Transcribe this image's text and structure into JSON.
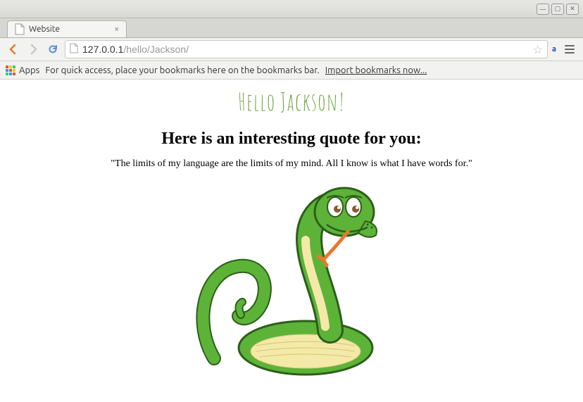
{
  "window": {
    "tab_title": "Website"
  },
  "toolbar": {
    "url_host": "127.0.0.1",
    "url_path": "/hello/Jackson/"
  },
  "bookmarks": {
    "apps_label": "Apps",
    "hint": "For quick access, place your bookmarks here on the bookmarks bar.",
    "import_link": "Import bookmarks now..."
  },
  "page": {
    "heading": "Hello Jackson!",
    "subheading": "Here is an interesting quote for you:",
    "quote": "\"The limits of my language are the limits of my mind. All I know is what I have words for.\"",
    "image_alt": "cartoon-snake"
  }
}
